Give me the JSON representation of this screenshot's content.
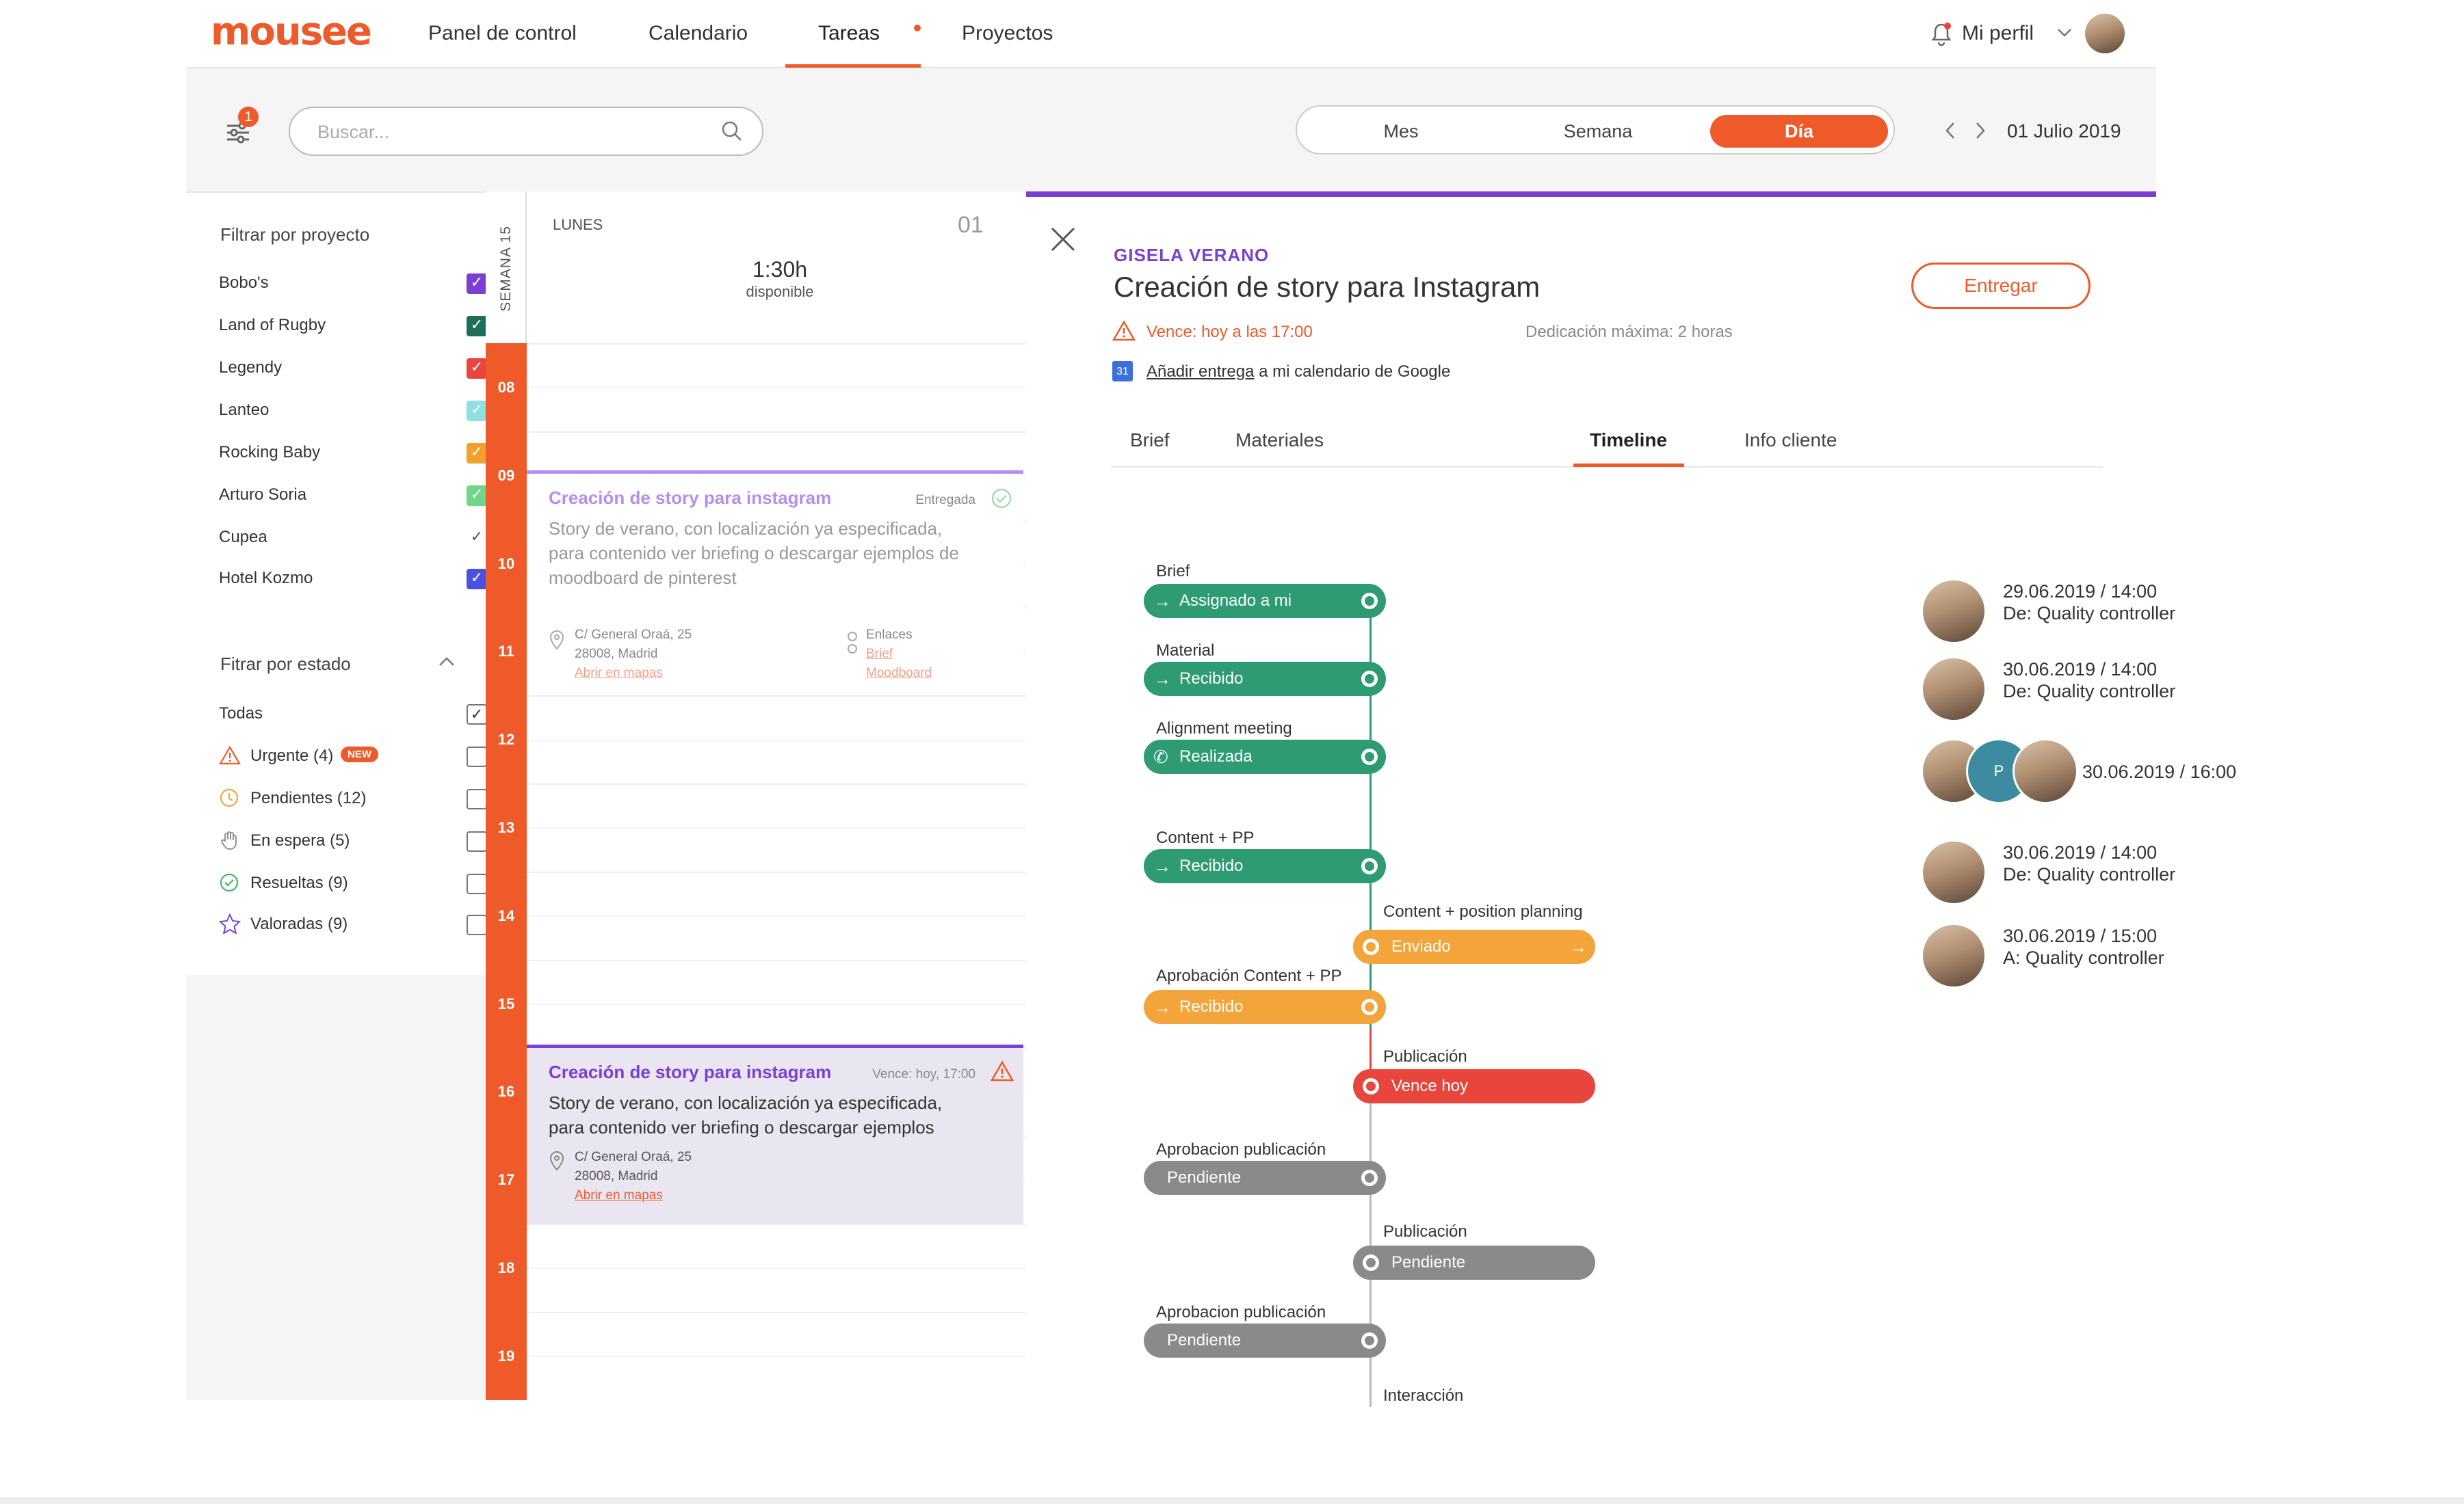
{
  "nav": {
    "logo": "mousee",
    "items": [
      "Panel de control",
      "Calendario",
      "Tareas",
      "Proyectos"
    ],
    "profile": "Mi perfil"
  },
  "toolbar": {
    "filter_badge": "1",
    "search_placeholder": "Buscar...",
    "views": [
      "Mes",
      "Semana",
      "Día"
    ],
    "active_view": "Día",
    "date": "01 Julio 2019"
  },
  "sidebar": {
    "projects_title": "Filtrar por proyecto",
    "projects": [
      {
        "label": "Bobo's",
        "color": "#7a3fd3"
      },
      {
        "label": "Land of Rugby",
        "color": "#1f6e57"
      },
      {
        "label": "Legendy",
        "color": "#e8453c"
      },
      {
        "label": "Lanteo",
        "color": "#8fe0e0"
      },
      {
        "label": "Rocking Baby",
        "color": "#f3a12d"
      },
      {
        "label": "Arturo Soria",
        "color": "#6fd68a"
      },
      {
        "label": "Cupea",
        "color": ""
      },
      {
        "label": "Hotel Kozmo",
        "color": "#4a50e0"
      }
    ],
    "status_title": "Fitrar por estado",
    "statuses": [
      {
        "label": "Todas",
        "icon": "",
        "checked": true
      },
      {
        "label": "Urgente (4)",
        "icon": "warning-icon",
        "badge": "NEW",
        "checked": false
      },
      {
        "label": "Pendientes (12)",
        "icon": "clock-icon",
        "checked": false
      },
      {
        "label": "En espera (5)",
        "icon": "hand-icon",
        "checked": false
      },
      {
        "label": "Resueltas (9)",
        "icon": "check-circle-icon",
        "checked": false
      },
      {
        "label": "Valoradas (9)",
        "icon": "star-icon",
        "checked": false
      }
    ]
  },
  "calendar": {
    "week_label": "SEMANA 15",
    "day_name": "LUNES",
    "day_number": "01",
    "available_hours": "1:30h",
    "available_label": "disponible",
    "hours": [
      "08",
      "09",
      "10",
      "11",
      "12",
      "13",
      "14",
      "15",
      "16",
      "17",
      "18",
      "19"
    ],
    "event1": {
      "title": "Creación de story para instagram",
      "status": "Entregada",
      "desc": "Story de verano, con localización ya especificada, para contenido ver briefing o descargar ejemplos de moodboard de pinterest",
      "addr1": "C/ General Oraá, 25",
      "addr2": "28008, Madrid",
      "map_link": "Abrir en mapas",
      "links_label": "Enlaces",
      "link1": "Brief",
      "link2": "Moodboard"
    },
    "event2": {
      "title": "Creación de story para instagram",
      "status": "Vence: hoy, 17:00",
      "desc": "Story de verano, con localización ya especificada, para contenido ver briefing o descargar ejemplos",
      "addr1": "C/ General Oraá, 25",
      "addr2": "28008, Madrid",
      "map_link": "Abrir en mapas"
    }
  },
  "detail": {
    "client": "GISELA VERANO",
    "title": "Creación de story para Instagram",
    "deliver_button": "Entregar",
    "due": "Vence: hoy a las 17:00",
    "max_dedication": "Dedicación máxima: 2 horas",
    "calendar_link": "Añadir entrega",
    "calendar_rest": " a mi calendario de Google",
    "calendar_icon_text": "31",
    "tabs": [
      "Brief",
      "Materiales",
      "Timeline",
      "Info cliente"
    ],
    "active_tab": "Timeline",
    "timeline": [
      {
        "label": "Brief",
        "status": "Assignado a mi",
        "color": "#2e9b72",
        "icon": "→"
      },
      {
        "label": "Material",
        "status": "Recibido",
        "color": "#2e9b72",
        "icon": "→"
      },
      {
        "label": "Alignment meeting",
        "status": "Realizada",
        "color": "#2e9b72",
        "icon": "✆"
      },
      {
        "label": "Content + PP",
        "status": "Recibido",
        "color": "#2e9b72",
        "icon": "→"
      },
      {
        "label": "Content + position planning",
        "status": "Enviado",
        "color": "#f3a43a",
        "icon": "→"
      },
      {
        "label": "Aprobación Content + PP",
        "status": "Recibido",
        "color": "#f3a43a",
        "icon": "→"
      },
      {
        "label": "Publicación",
        "status": "Vence hoy",
        "color": "#e8453c",
        "icon": ""
      },
      {
        "label": "Aprobacion publicación",
        "status": "Pendiente",
        "color": "#8a8a8a",
        "icon": ""
      },
      {
        "label": "Publicación",
        "status": "Pendiente",
        "color": "#8a8a8a",
        "icon": ""
      },
      {
        "label": "Aprobacion publicación",
        "status": "Pendiente",
        "color": "#8a8a8a",
        "icon": ""
      },
      {
        "label": "Interacción",
        "status": "",
        "color": "#8a8a8a",
        "icon": ""
      }
    ],
    "history": [
      {
        "date": "29.06.2019 / 14:00",
        "who": "De: Quality controller"
      },
      {
        "date": "30.06.2019 / 14:00",
        "who": "De: Quality controller"
      },
      {
        "date": "30.06.2019 / 16:00",
        "who": "",
        "group_initial": "P"
      },
      {
        "date": "30.06.2019 / 14:00",
        "who": "De: Quality controller"
      },
      {
        "date": "30.06.2019 / 15:00",
        "who": "A: Quality controller"
      }
    ]
  }
}
